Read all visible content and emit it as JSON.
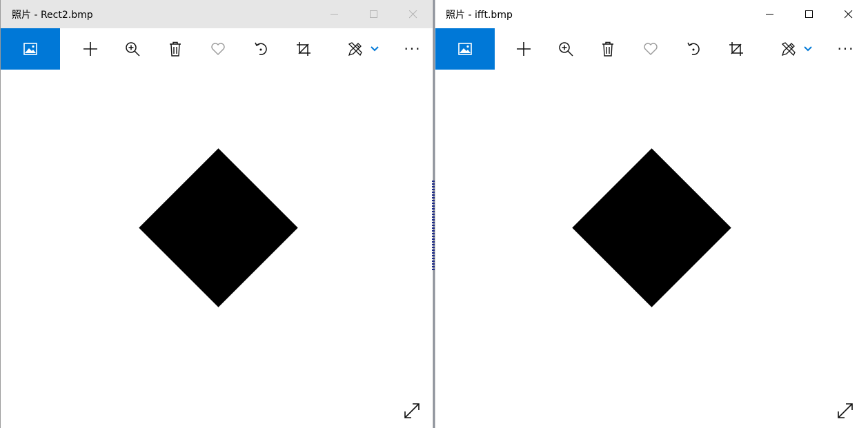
{
  "windows": [
    {
      "title": "照片 - Rect2.bmp",
      "state": "inactive"
    },
    {
      "title": "照片 - ifft.bmp",
      "state": "active"
    }
  ],
  "toolbar_icons": [
    "photo-icon",
    "add-icon",
    "zoom-icon",
    "delete-icon",
    "favorite-icon",
    "rotate-icon",
    "crop-icon",
    "edit-icon",
    "chevron-down-icon",
    "more-icon"
  ],
  "more_label": "···",
  "colors": {
    "accent": "#0078d7",
    "inactive_titlebar": "#e6e6e6",
    "image_shape": "#000000"
  }
}
